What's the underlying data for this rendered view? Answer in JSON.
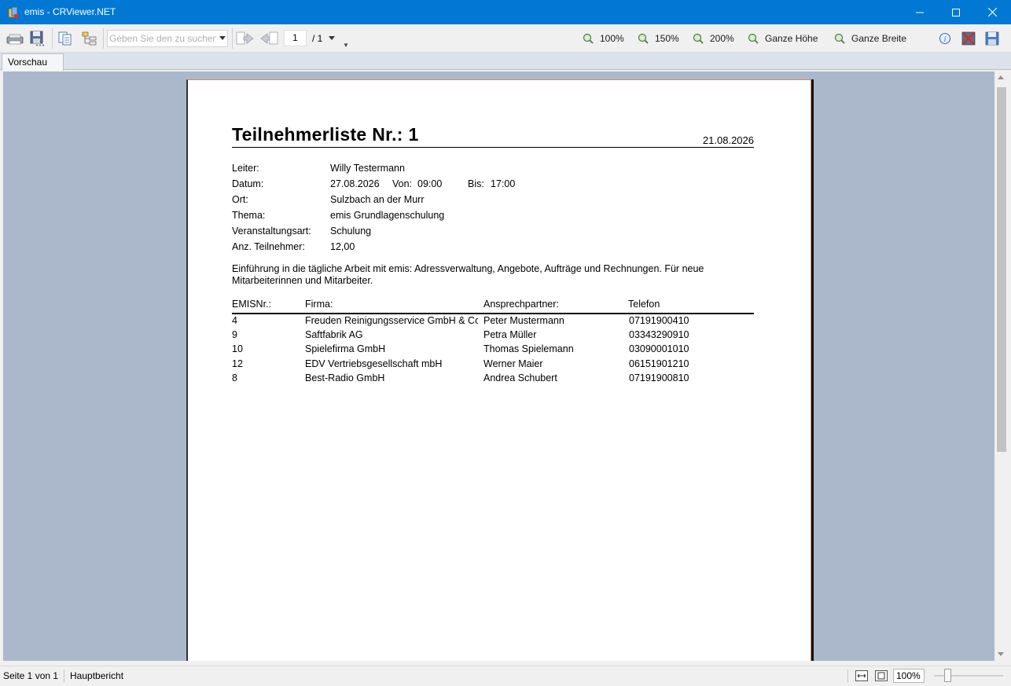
{
  "window": {
    "title": "emis - CRViewer.NET"
  },
  "toolbar": {
    "search_placeholder": "Geben Sie den zu suchenden Text ein",
    "search_value": "",
    "current_page": "1",
    "page_total": "/ 1",
    "zoom_buttons": [
      {
        "label": "100%"
      },
      {
        "label": "150%"
      },
      {
        "label": "200%"
      },
      {
        "label": "Ganze Höhe"
      },
      {
        "label": "Ganze Breite"
      }
    ]
  },
  "tabs": [
    {
      "label": "Vorschau"
    }
  ],
  "report": {
    "title": "Teilnehmerliste Nr.: 1",
    "date": "21.08.2026",
    "fields": [
      {
        "label": "Leiter:",
        "value": "Willy Testermann"
      },
      {
        "label": "Datum:",
        "value": "27.08.2026"
      },
      {
        "label": "Ort:",
        "value": "Sulzbach an der Murr"
      },
      {
        "label": "Thema:",
        "value": "emis Grundlagenschulung"
      },
      {
        "label": "Veranstaltungsart:",
        "value": "Schulung"
      },
      {
        "label": "Anz. Teilnehmer:",
        "value": "12,00"
      }
    ],
    "von_label": "Von:",
    "von_value": "09:00",
    "bis_label": "Bis:",
    "bis_value": "17:00",
    "description": "Einführung in die tägliche Arbeit mit emis: Adressverwaltung, Angebote, Aufträge und Rechnungen. Für neue Mitarbeiterinnen und Mitarbeiter.",
    "columns": [
      "EMISNr.:",
      "Firma:",
      "Ansprechpartner:",
      "Telefon"
    ],
    "rows": [
      [
        "4",
        "Freuden Reinigungsservice GmbH & Co. KG",
        "Peter Mustermann",
        "07191900410"
      ],
      [
        "9",
        "Saftfabrik AG",
        "Petra Müller",
        "03343290910"
      ],
      [
        "10",
        "Spielefirma GmbH",
        "Thomas Spielemann",
        "03090001010"
      ],
      [
        "12",
        "EDV Vertriebsgesellschaft mbH",
        "Werner Maier",
        "06151901210"
      ],
      [
        "8",
        "Best-Radio GmbH",
        "Andrea Schubert",
        "07191900810"
      ]
    ]
  },
  "statusbar": {
    "page_info": "Seite 1 von 1",
    "report_name": "Hauptbericht",
    "zoom_value": "100%"
  },
  "colors": {
    "titlebar": "#0078d4",
    "preview_bg": "#abb8cb"
  }
}
